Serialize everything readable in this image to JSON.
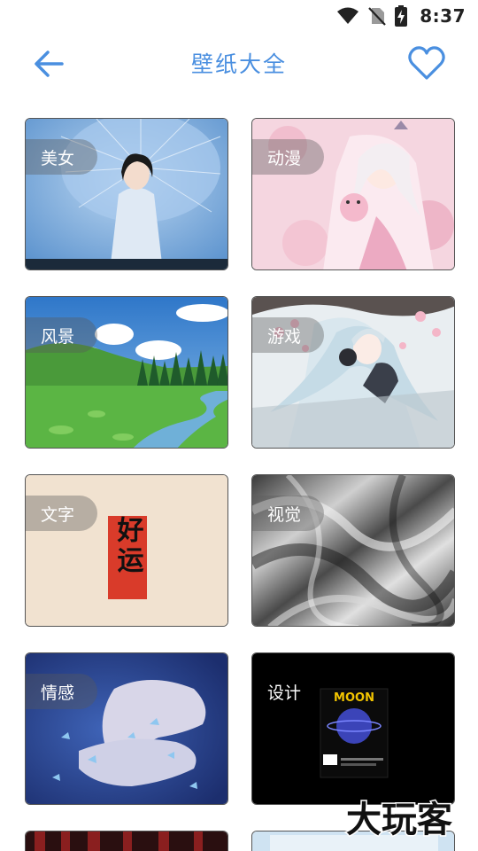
{
  "status_bar": {
    "time": "8:37"
  },
  "header": {
    "title": "壁纸大全"
  },
  "categories": [
    {
      "label": "美女"
    },
    {
      "label": "动漫"
    },
    {
      "label": "风景"
    },
    {
      "label": "游戏"
    },
    {
      "label": "文字",
      "art_text": "好运"
    },
    {
      "label": "视觉"
    },
    {
      "label": "情感"
    },
    {
      "label": "设计",
      "art_text": "MOON"
    }
  ],
  "watermark": "大玩客",
  "colors": {
    "accent": "#4a8fe0"
  }
}
